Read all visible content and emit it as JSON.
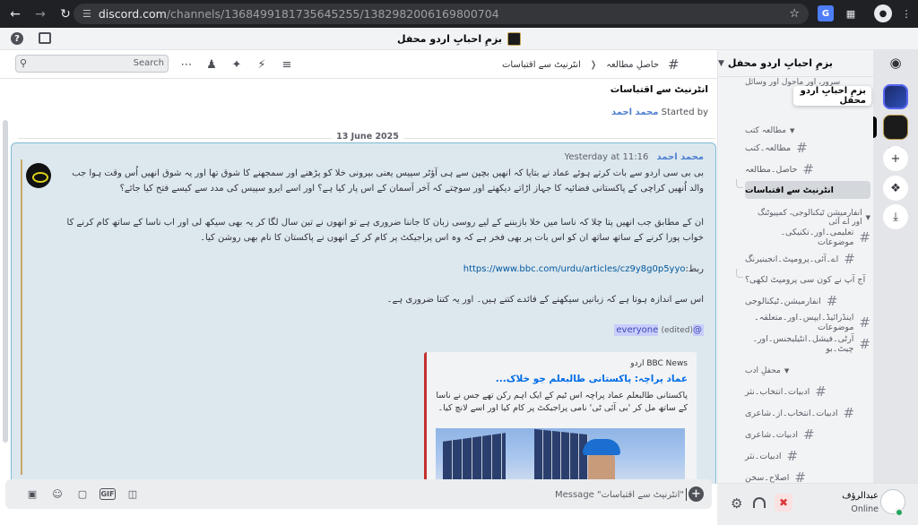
{
  "browser": {
    "url_host": "discord.com",
    "url_path": "/channels/1368499181735645255/1382982006169800704"
  },
  "titlebar": {
    "server_name": "بزمِ احبابِ اردو محفل"
  },
  "tooltip": {
    "text": "بزمِ احبابِ اردو محفل"
  },
  "toolbar": {
    "search_placeholder": "Search",
    "breadcrumb_channel": "حاصلِ مطالعہ",
    "breadcrumb_thread": "انٹرنیٹ سے اقتباسات"
  },
  "sidebar": {
    "header": "بزمِ احبابِ اردو محفل",
    "rows": [
      {
        "label": "سرور، اور ماحول اور وسائل",
        "type": "channel"
      },
      {
        "label": "مطالعہ کتب",
        "type": "category"
      },
      {
        "label": "مطالعہ۔کتب",
        "type": "channel"
      },
      {
        "label": "حاصل۔مطالعہ",
        "type": "channel"
      },
      {
        "label": "انٹرنیٹ سے اقتباسات",
        "type": "thread"
      },
      {
        "label": "انفارمیشن ٹیکنالوجی، کمپیوٹنگ اور اے آئی",
        "type": "category"
      },
      {
        "label": "تعلیمی۔اور۔تکنیکی۔موضوعات",
        "type": "channel"
      },
      {
        "label": "اے۔آئی۔پرومپٹ۔انجینیرنگ",
        "type": "channel"
      },
      {
        "label": "آج آپ نے کون سی پرومپٹ لکھی؟",
        "type": "thread"
      },
      {
        "label": "انفارمیشن۔ٹیکنالوجی",
        "type": "channel"
      },
      {
        "label": "اینڈرائیڈ۔ایپس۔اور۔متعلقہ۔موضوعات",
        "type": "channel"
      },
      {
        "label": "آرٹی۔فیشل۔انٹیلیجنس۔اور۔چیٹ۔بو",
        "type": "channel"
      },
      {
        "label": "محفلِ ادب",
        "type": "category"
      },
      {
        "label": "ادبیات۔انتخاب۔نثر",
        "type": "channel"
      },
      {
        "label": "ادبیات۔انتخاب۔از۔شاعری",
        "type": "channel"
      },
      {
        "label": "ادبیات۔شاعری",
        "type": "channel"
      },
      {
        "label": "ادبیات۔نثر",
        "type": "channel"
      },
      {
        "label": "اصلاح۔سخن",
        "type": "channel"
      }
    ]
  },
  "user": {
    "name": "عبدالرؤف",
    "status": "Online"
  },
  "thread": {
    "title": "انٹرنیٹ سے اقتباسات",
    "started_label": "Started by",
    "started_author": "محمد احمد"
  },
  "date_divider": "13 June 2025",
  "message": {
    "author": "محمد احمد",
    "timestamp": "Yesterday at 11:16",
    "para1": "بی بی سی اردو سے بات کرتے ہوئے عماد نے بتایا کہ انھیں بچپن سے ہی آؤٹر سپیس یعنی بیرونی خلا کو پڑھنے اور سمجھنے کا شوق تھا اور یہ شوق انھیں اُس وقت ہوا جب والد اُنھیں کراچی کے پاکستانی فضائیہ کا جہاز اڑاتے دیکھتے اور سوچتے کہ آخر آسمان کے اس پار کیا ہے؟ اور اسے ایرو سپیس کی مدد سے کیسے فتح کیا جائے؟",
    "para2": "ان کے مطابق جب انھیں پتا چلا کہ ناسا میں خلا بازبننے کے لیے روسی زبان کا جاننا ضروری ہے تو انھوں نے تین سال لگا کر یہ بھی سیکھ لی اور اب ناسا کے ساتھ کام کرنے کا خواب پورا کرنے کے ساتھ ساتھ ان کو اس بات پر بھی فخر ہے کہ وہ اس پراجیکٹ پر کام کر کے انھوں نے پاکستان کا نام بھی روشن کیا۔",
    "link_label": "ربط:",
    "link_url": "https://www.bbc.com/urdu/articles/cz9y8g0p5yyo",
    "para3": "اس سے اندازہ ہوتا ہے کہ زبانیں سیکھنے کے فائدے کتنے ہیں۔ اور یہ کتنا ضروری ہے۔",
    "mention": "@everyone",
    "edited": "(edited)"
  },
  "embed": {
    "provider": "BBC News اردو",
    "title": "عماد پراچہ: پاکستانی طالبعلم جو خلاک...",
    "description": "پاکستانی طالبعلم عماد پراچہ اس ٹیم کے ایک اہم رکن تھے جس نے ناسا کے ساتھ مل کر 'بی آئی ٹی' نامی پراجیکٹ پر کام کیا اور اسے لانچ کیا۔"
  },
  "composer": {
    "placeholder": "Message \"انٹرنیٹ سے اقتباسات\""
  },
  "colors": {
    "accent": "#5865f2",
    "link": "#00579e",
    "mention_bg": "#c9cdfb",
    "embed_border": "#c3302d",
    "online": "#23a55a"
  }
}
